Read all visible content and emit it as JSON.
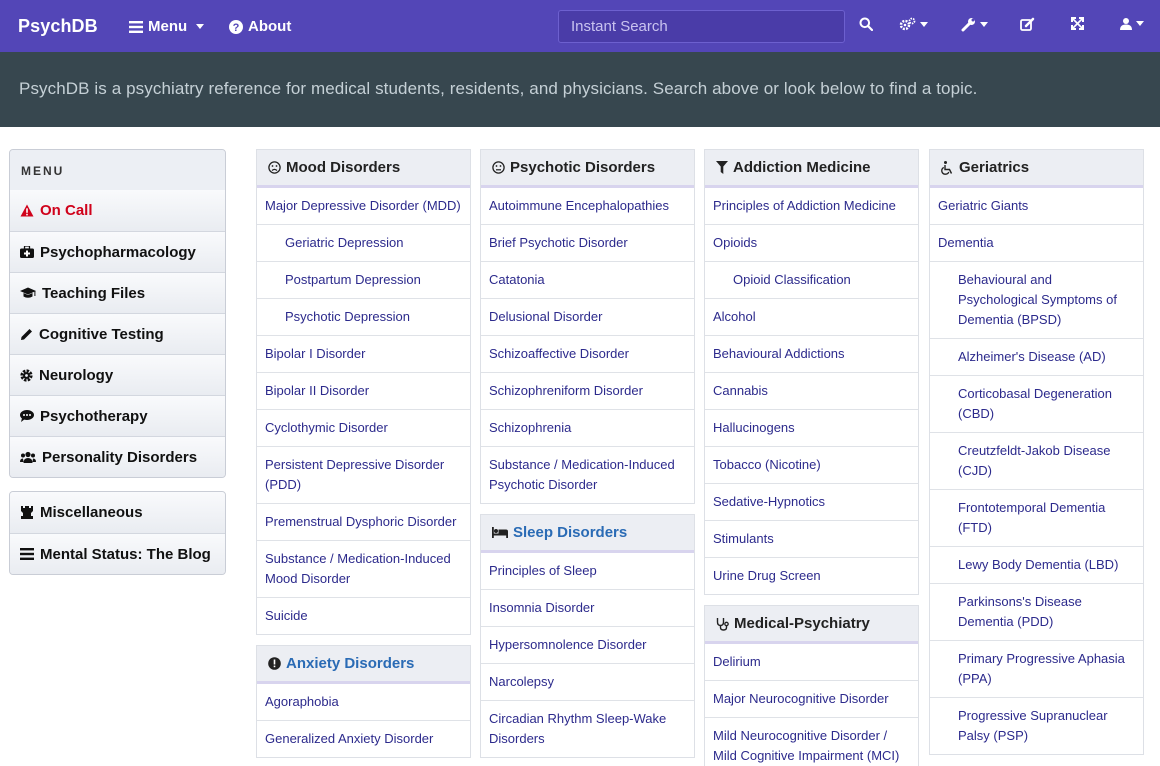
{
  "navbar": {
    "brand": "PsychDB",
    "menu_label": "Menu",
    "about_label": "About",
    "search_placeholder": "Instant Search"
  },
  "banner": {
    "text": "PsychDB is a psychiatry reference for medical students, residents, and physicians. Search above or look below to find a topic."
  },
  "sidebar": {
    "header": "MENU",
    "items": [
      {
        "label": "On Call",
        "icon": "warning-icon"
      },
      {
        "label": "Psychopharmacology",
        "icon": "medkit-icon"
      },
      {
        "label": "Teaching Files",
        "icon": "graduation-cap-icon"
      },
      {
        "label": "Cognitive Testing",
        "icon": "pencil-icon"
      },
      {
        "label": "Neurology",
        "icon": "gear-icon"
      },
      {
        "label": "Psychotherapy",
        "icon": "comment-icon"
      },
      {
        "label": "Personality Disorders",
        "icon": "users-icon"
      }
    ],
    "extra": [
      {
        "label": "Miscellaneous",
        "icon": "chess-icon"
      },
      {
        "label": "Mental Status: The Blog",
        "icon": "bars-icon"
      }
    ]
  },
  "columns": {
    "mood": {
      "title": "Mood Disorders",
      "items": [
        {
          "label": "Major Depressive Disorder (MDD)",
          "sub": false
        },
        {
          "label": "Geriatric Depression",
          "sub": true
        },
        {
          "label": "Postpartum Depression",
          "sub": true
        },
        {
          "label": "Psychotic Depression",
          "sub": true
        },
        {
          "label": "Bipolar I Disorder",
          "sub": false
        },
        {
          "label": "Bipolar II Disorder",
          "sub": false
        },
        {
          "label": "Cyclothymic Disorder",
          "sub": false
        },
        {
          "label": "Persistent Depressive Disorder (PDD)",
          "sub": false
        },
        {
          "label": "Premenstrual Dysphoric Disorder",
          "sub": false
        },
        {
          "label": "Substance / Medication-Induced Mood Disorder",
          "sub": false
        },
        {
          "label": "Suicide",
          "sub": false
        }
      ]
    },
    "anxiety": {
      "title": "Anxiety Disorders",
      "items": [
        {
          "label": "Agoraphobia",
          "sub": false
        },
        {
          "label": "Generalized Anxiety Disorder",
          "sub": false
        }
      ]
    },
    "psychotic": {
      "title": "Psychotic Disorders",
      "items": [
        {
          "label": "Autoimmune Encephalopathies",
          "sub": false
        },
        {
          "label": "Brief Psychotic Disorder",
          "sub": false
        },
        {
          "label": "Catatonia",
          "sub": false
        },
        {
          "label": "Delusional Disorder",
          "sub": false
        },
        {
          "label": "Schizoaffective Disorder",
          "sub": false
        },
        {
          "label": "Schizophreniform Disorder",
          "sub": false
        },
        {
          "label": "Schizophrenia",
          "sub": false
        },
        {
          "label": "Substance / Medication-Induced Psychotic Disorder",
          "sub": false
        }
      ]
    },
    "sleep": {
      "title": "Sleep Disorders",
      "items": [
        {
          "label": "Principles of Sleep",
          "sub": false
        },
        {
          "label": "Insomnia Disorder",
          "sub": false
        },
        {
          "label": "Hypersomnolence Disorder",
          "sub": false
        },
        {
          "label": "Narcolepsy",
          "sub": false
        },
        {
          "label": "Circadian Rhythm Sleep-Wake Disorders",
          "sub": false
        }
      ]
    },
    "addiction": {
      "title": "Addiction Medicine",
      "items": [
        {
          "label": "Principles of Addiction Medicine",
          "sub": false
        },
        {
          "label": "Opioids",
          "sub": false
        },
        {
          "label": "Opioid Classification",
          "sub": true
        },
        {
          "label": "Alcohol",
          "sub": false
        },
        {
          "label": "Behavioural Addictions",
          "sub": false
        },
        {
          "label": "Cannabis",
          "sub": false
        },
        {
          "label": "Hallucinogens",
          "sub": false
        },
        {
          "label": "Tobacco (Nicotine)",
          "sub": false
        },
        {
          "label": "Sedative-Hypnotics",
          "sub": false
        },
        {
          "label": "Stimulants",
          "sub": false
        },
        {
          "label": "Urine Drug Screen",
          "sub": false
        }
      ]
    },
    "medpsych": {
      "title": "Medical-Psychiatry",
      "items": [
        {
          "label": "Delirium",
          "sub": false
        },
        {
          "label": "Major Neurocognitive Disorder",
          "sub": false
        },
        {
          "label": "Mild Neurocognitive Disorder / Mild Cognitive Impairment (MCI)",
          "sub": false
        }
      ]
    },
    "geriatrics": {
      "title": "Geriatrics",
      "items": [
        {
          "label": "Geriatric Giants",
          "sub": false
        },
        {
          "label": "Dementia",
          "sub": false
        },
        {
          "label": "Behavioural and Psychological Symptoms of Dementia (BPSD)",
          "sub": true
        },
        {
          "label": "Alzheimer's Disease (AD)",
          "sub": true
        },
        {
          "label": "Corticobasal Degeneration (CBD)",
          "sub": true
        },
        {
          "label": "Creutzfeldt-Jakob Disease (CJD)",
          "sub": true
        },
        {
          "label": "Frontotemporal Dementia (FTD)",
          "sub": true
        },
        {
          "label": "Lewy Body Dementia (LBD)",
          "sub": true
        },
        {
          "label": "Parkinsons's Disease Dementia (PDD)",
          "sub": true
        },
        {
          "label": "Primary Progressive Aphasia (PPA)",
          "sub": true
        },
        {
          "label": "Progressive Supranuclear Palsy (PSP)",
          "sub": true
        }
      ]
    }
  }
}
